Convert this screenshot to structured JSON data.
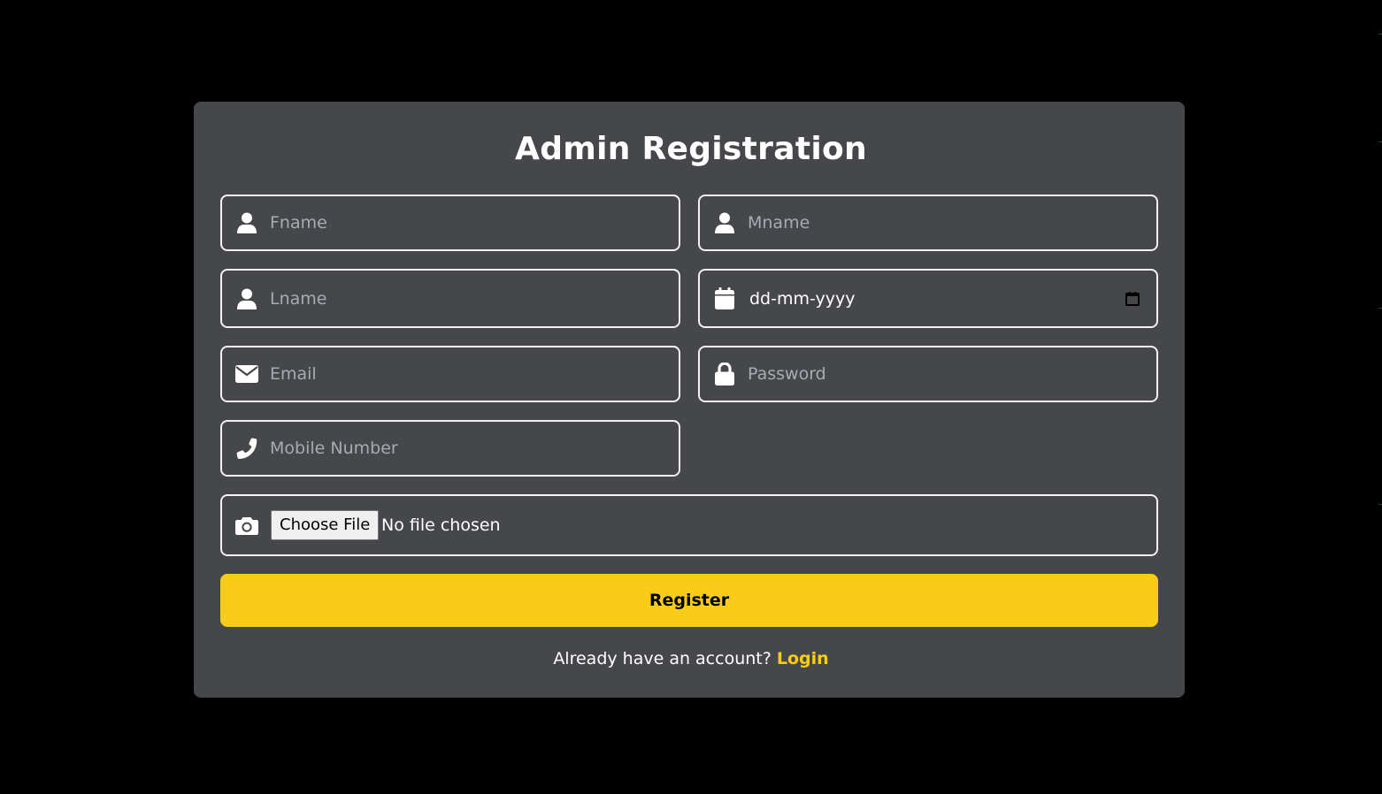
{
  "form": {
    "title": "Admin Registration",
    "fields": {
      "fname": {
        "placeholder": "Fname",
        "icon": "user-icon"
      },
      "mname": {
        "placeholder": "Mname",
        "icon": "user-icon"
      },
      "lname": {
        "placeholder": "Lname",
        "icon": "user-icon"
      },
      "dob": {
        "value": "dd-mm-yyyy",
        "icon": "calendar-icon"
      },
      "email": {
        "placeholder": "Email",
        "icon": "envelope-icon"
      },
      "password": {
        "placeholder": "Password",
        "icon": "lock-icon"
      },
      "mobile": {
        "placeholder": "Mobile Number",
        "icon": "phone-icon"
      },
      "photo": {
        "button_label": "Choose File",
        "status": "No file chosen",
        "icon": "camera-icon"
      }
    },
    "register_label": "Register",
    "footer": {
      "prompt": "Already have an account?",
      "login_label": "Login"
    }
  },
  "colors": {
    "page_background": "#000000",
    "card_background": "#46474a",
    "field_border": "#f2f2f2",
    "placeholder": "#a7abb3",
    "accent": "#f9cd17",
    "text": "#ffffff"
  }
}
